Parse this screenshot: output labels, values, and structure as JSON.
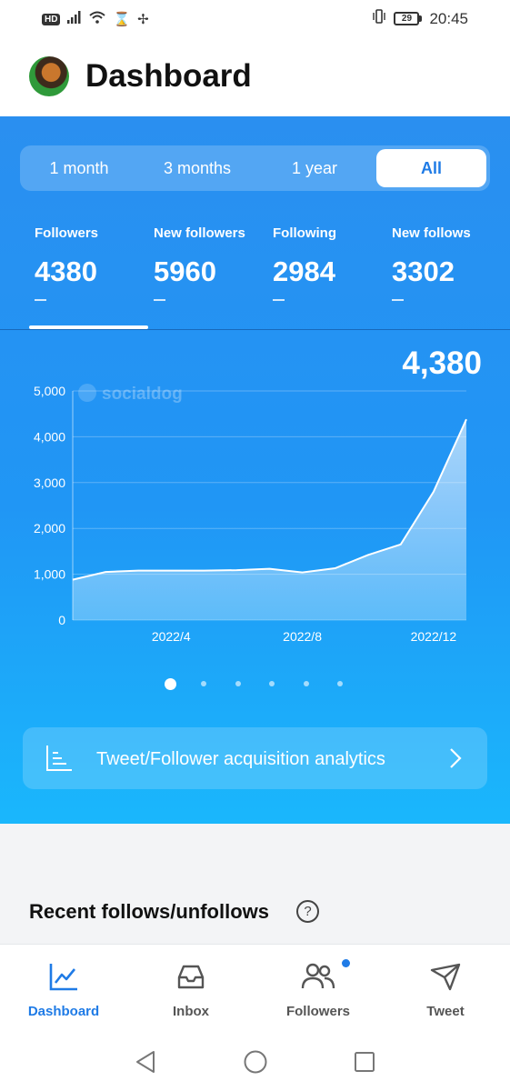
{
  "status_bar": {
    "left_icons": [
      "hd-icon",
      "signal-icon",
      "wifi-icon",
      "hourglass-icon",
      "fan-icon"
    ],
    "hd_label": "HD",
    "battery_level": "29",
    "time": "20:45"
  },
  "header": {
    "title": "Dashboard"
  },
  "period_tabs": [
    {
      "label": "1 month",
      "active": false
    },
    {
      "label": "3 months",
      "active": false
    },
    {
      "label": "1 year",
      "active": false
    },
    {
      "label": "All",
      "active": true
    }
  ],
  "stats": [
    {
      "label": "Followers",
      "value": "4380",
      "change": "—"
    },
    {
      "label": "New followers",
      "value": "5960",
      "change": "—"
    },
    {
      "label": "Following",
      "value": "2984",
      "change": "—"
    },
    {
      "label": "New follows",
      "value": "3302",
      "change": "—"
    }
  ],
  "selected_stat_value": "4,380",
  "chart_data": {
    "type": "area",
    "watermark": "socialdog",
    "x_tick_labels": [
      "2022/4",
      "2022/8",
      "2022/12"
    ],
    "y_tick_labels": [
      "5,000",
      "4,000",
      "3,000",
      "2,000",
      "1,000",
      "0"
    ],
    "ylim": [
      0,
      5000
    ],
    "x": [
      "2022/1",
      "2022/2",
      "2022/3",
      "2022/4",
      "2022/5",
      "2022/6",
      "2022/7",
      "2022/8",
      "2022/9",
      "2022/10",
      "2022/11",
      "2022/12",
      "2023/1"
    ],
    "series": [
      {
        "values": [
          880,
          1050,
          1080,
          1080,
          1080,
          1090,
          1120,
          1040,
          1130,
          1420,
          1650,
          2800,
          4380
        ]
      }
    ],
    "grid": true,
    "color": "#ffffff"
  },
  "pager": {
    "count": 6,
    "active_index": 0
  },
  "analytics": {
    "label": "Tweet/Follower acquisition analytics"
  },
  "recent": {
    "title": "Recent follows/unfollows",
    "help_symbol": "?"
  },
  "bottom_nav": [
    {
      "label": "Dashboard",
      "icon": "chart-line-icon",
      "active": true
    },
    {
      "label": "Inbox",
      "icon": "inbox-icon",
      "active": false
    },
    {
      "label": "Followers",
      "icon": "people-icon",
      "active": false,
      "badge": true
    },
    {
      "label": "Tweet",
      "icon": "send-icon",
      "active": false
    }
  ],
  "colors": {
    "accent": "#1f7be6",
    "panel_top": "#2a8ff0",
    "panel_bottom": "#1ab7fc"
  }
}
